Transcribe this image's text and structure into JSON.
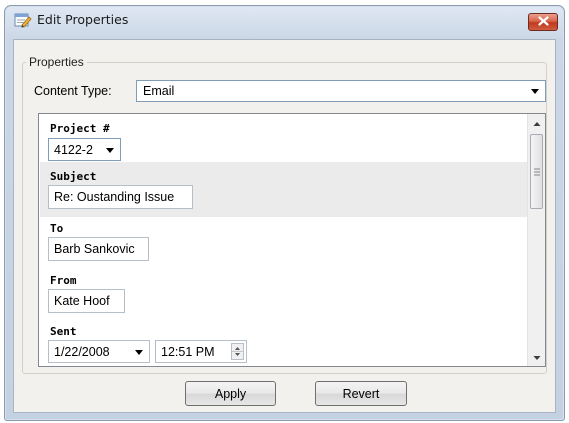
{
  "window": {
    "title": "Edit Properties",
    "title_icon": "edit-properties-icon",
    "close_icon": "close-icon"
  },
  "properties": {
    "group_label": "Properties",
    "content_type_label": "Content Type:",
    "content_type_value": "Email"
  },
  "fields": {
    "project": {
      "label": "Project #",
      "value": "4122-2"
    },
    "subject": {
      "label": "Subject",
      "value": "Re: Oustanding Issue"
    },
    "to": {
      "label": "To",
      "value": "Barb Sankovic"
    },
    "from": {
      "label": "From",
      "value": "Kate Hoof"
    },
    "sent": {
      "label": "Sent",
      "date": "1/22/2008",
      "time": "12:51 PM"
    }
  },
  "buttons": {
    "apply": "Apply",
    "revert": "Revert"
  },
  "colors": {
    "close_button": "#d9644a",
    "selected_row": "#ebebeb",
    "border_blue": "#7f9db9"
  }
}
